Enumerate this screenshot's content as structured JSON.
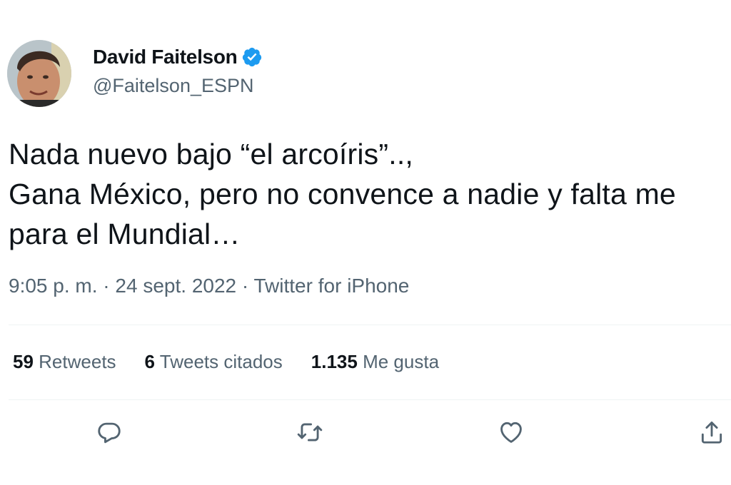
{
  "author": {
    "display_name": "David Faitelson",
    "handle": "@Faitelson_ESPN",
    "verified": true
  },
  "tweet": {
    "lines": [
      "Nada nuevo bajo “el arcoíris”..,",
      "Gana México, pero no convence a nadie y falta me",
      "para el Mundial…"
    ]
  },
  "meta": {
    "time": "9:05 p. m.",
    "separator_1": " · ",
    "date": "24 sept. 2022",
    "separator_2": " · ",
    "source": "Twitter for iPhone"
  },
  "stats": {
    "retweets_count": "59",
    "retweets_label": "Retweets",
    "quotes_count": "6",
    "quotes_label": "Tweets citados",
    "likes_count": "1.135",
    "likes_label": "Me gusta"
  },
  "actions": [
    "reply-icon",
    "retweet-icon",
    "like-icon",
    "share-icon"
  ],
  "colors": {
    "text": "#0f1419",
    "secondary": "#536471",
    "verified": "#1d9bf0",
    "divider": "#eff3f4"
  }
}
